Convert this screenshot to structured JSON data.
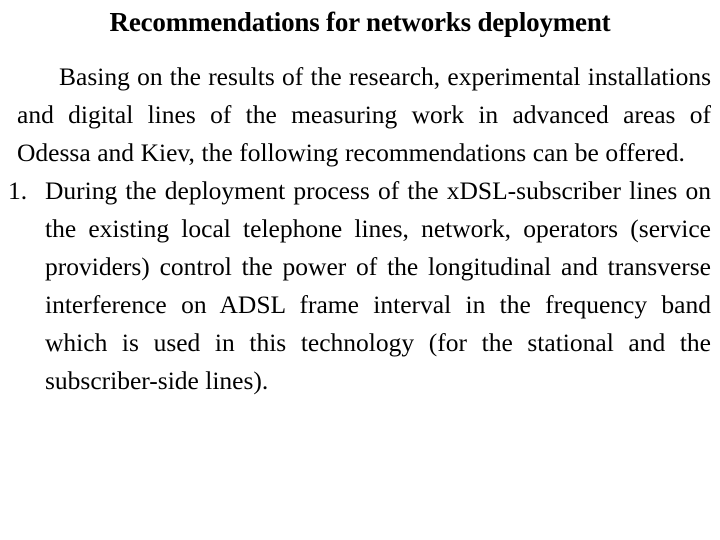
{
  "slide": {
    "title": "Recommendations for networks deployment",
    "background_color": "#ffffff",
    "text_color": "#000000",
    "intro_paragraph": "Basing on the results of the research, experimental installations and digital lines of the measuring work in advanced areas of Odessa and Kiev, the following recommendations can be offered.",
    "list": {
      "items": [
        {
          "marker": "1.",
          "text": "During the deployment process of the xDSL-subscriber lines on the existing local telephone lines, network, operators (service providers) control the power of the longitudinal and transverse interference on ADSL frame interval in the frequency band which is used in this technology (for the stational and the subscriber-side lines)."
        }
      ]
    }
  }
}
